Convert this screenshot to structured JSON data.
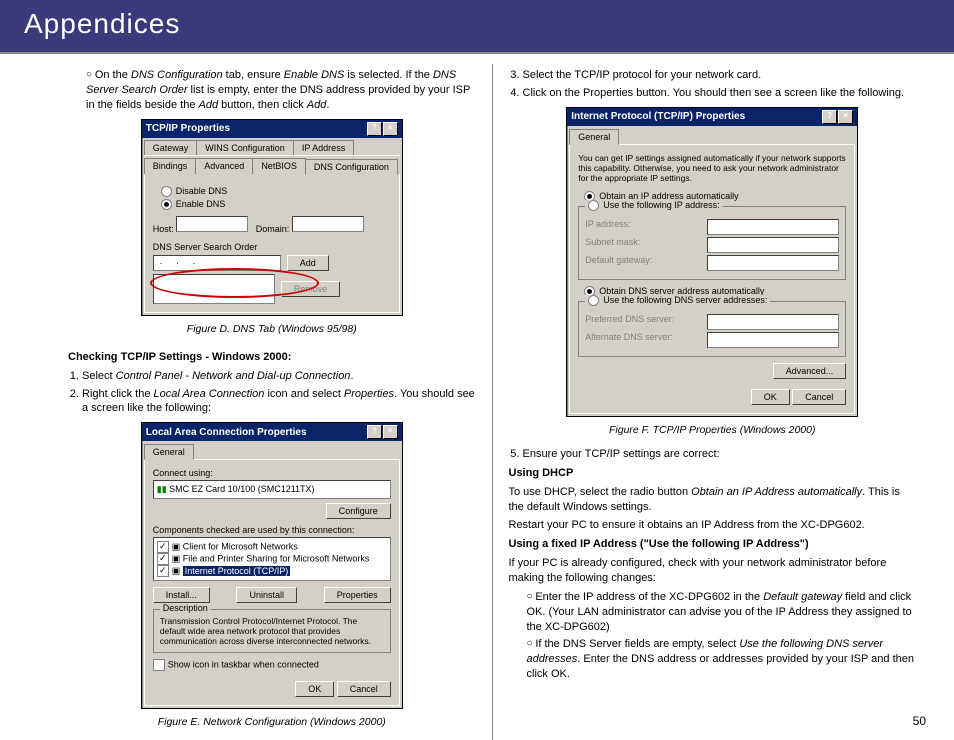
{
  "header": {
    "title": "Appendices"
  },
  "page_number": "50",
  "left": {
    "intro_bullet": {
      "p1a": "On the ",
      "p1b": "DNS Configuration",
      "p1c": " tab, ensure ",
      "p1d": "Enable DNS",
      "p1e": " is selected. If the ",
      "p1f": "DNS Server Search Order",
      "p1g": " list is empty, enter the DNS address provided by your ISP in the fields beside the ",
      "p1h": "Add",
      "p1i": " button, then click ",
      "p1j": "Add",
      "p1k": "."
    },
    "figD": {
      "title": "TCP/IP Properties",
      "tabs_row1": [
        "Gateway",
        "WINS Configuration",
        "IP Address"
      ],
      "tabs_row2": [
        "Bindings",
        "Advanced",
        "NetBIOS",
        "DNS Configuration"
      ],
      "disable_dns": "Disable DNS",
      "enable_dns": "Enable DNS",
      "host": "Host:",
      "domain": "Domain:",
      "search_order": "DNS Server Search Order",
      "add": "Add",
      "remove": "Remove",
      "caption": "Figure D. DNS Tab (Windows 95/98)"
    },
    "check_heading": "Checking TCP/IP Settings - Windows 2000:",
    "step1": {
      "a": "Select ",
      "b": "Control Panel - Network and Dial-up Connection",
      "c": "."
    },
    "step2": {
      "a": "Right click the ",
      "b": "Local Area Connection",
      "c": " icon and select ",
      "d": "Properties",
      "e": ". You should see a screen like the following:"
    },
    "figE": {
      "title": "Local Area Connection Properties",
      "tab": "General",
      "connect_using": "Connect using:",
      "nic": "SMC EZ Card 10/100 (SMC1211TX)",
      "configure": "Configure",
      "components_label": "Components checked are used by this connection:",
      "comp1": "Client for Microsoft Networks",
      "comp2": "File and Printer Sharing for Microsoft Networks",
      "comp3": "Internet Protocol (TCP/IP)",
      "install": "Install...",
      "uninstall": "Uninstall",
      "properties": "Properties",
      "description_label": "Description",
      "description_text": "Transmission Control Protocol/Internet Protocol. The default wide area network protocol that provides communication across diverse interconnected networks.",
      "show_icon": "Show icon in taskbar when connected",
      "ok": "OK",
      "cancel": "Cancel",
      "caption": "Figure E. Network Configuration (Windows 2000)"
    }
  },
  "right": {
    "step3": "Select the TCP/IP protocol for your network card.",
    "step4": "Click on the Properties button. You should then see a screen like the following.",
    "figF": {
      "title": "Internet Protocol (TCP/IP) Properties",
      "tab": "General",
      "blurb": "You can get IP settings assigned automatically if your network supports this capability. Otherwise, you need to ask your network administrator for the appropriate IP settings.",
      "obtain_ip": "Obtain an IP address automatically",
      "use_ip": "Use the following IP address:",
      "ip": "IP address:",
      "mask": "Subnet mask:",
      "gw": "Default gateway:",
      "obtain_dns": "Obtain DNS server address automatically",
      "use_dns": "Use the following DNS server addresses:",
      "pref": "Preferred DNS server:",
      "alt": "Alternate DNS server:",
      "advanced": "Advanced...",
      "ok": "OK",
      "cancel": "Cancel",
      "caption": "Figure F. TCP/IP Properties (Windows 2000)"
    },
    "step5": "Ensure your TCP/IP settings are correct:",
    "using_dhcp_h": "Using DHCP",
    "dhcp_p": {
      "a": "To use DHCP, select the radio button ",
      "b": "Obtain an IP Address automatically",
      "c": ". This is the default Windows settings."
    },
    "dhcp_restart": "Restart your PC to ensure it obtains an IP Address from the XC-DPG602.",
    "fixed_h": "Using a fixed IP Address (\"Use the following IP Address\")",
    "fixed_intro": "If your PC is already configured, check with your network administrator before making the following changes:",
    "fixed_b1": {
      "a": "Enter the IP address of the XC-DPG602 in the ",
      "b": "Default gateway",
      "c": " field and click OK. (Your LAN administrator can advise you of the IP Address they assigned to the XC-DPG602)"
    },
    "fixed_b2": {
      "a": "If the DNS Server fields are empty, select ",
      "b": "Use the following DNS server addresses",
      "c": ". Enter the DNS address or addresses provided by your ISP and then click OK."
    }
  }
}
